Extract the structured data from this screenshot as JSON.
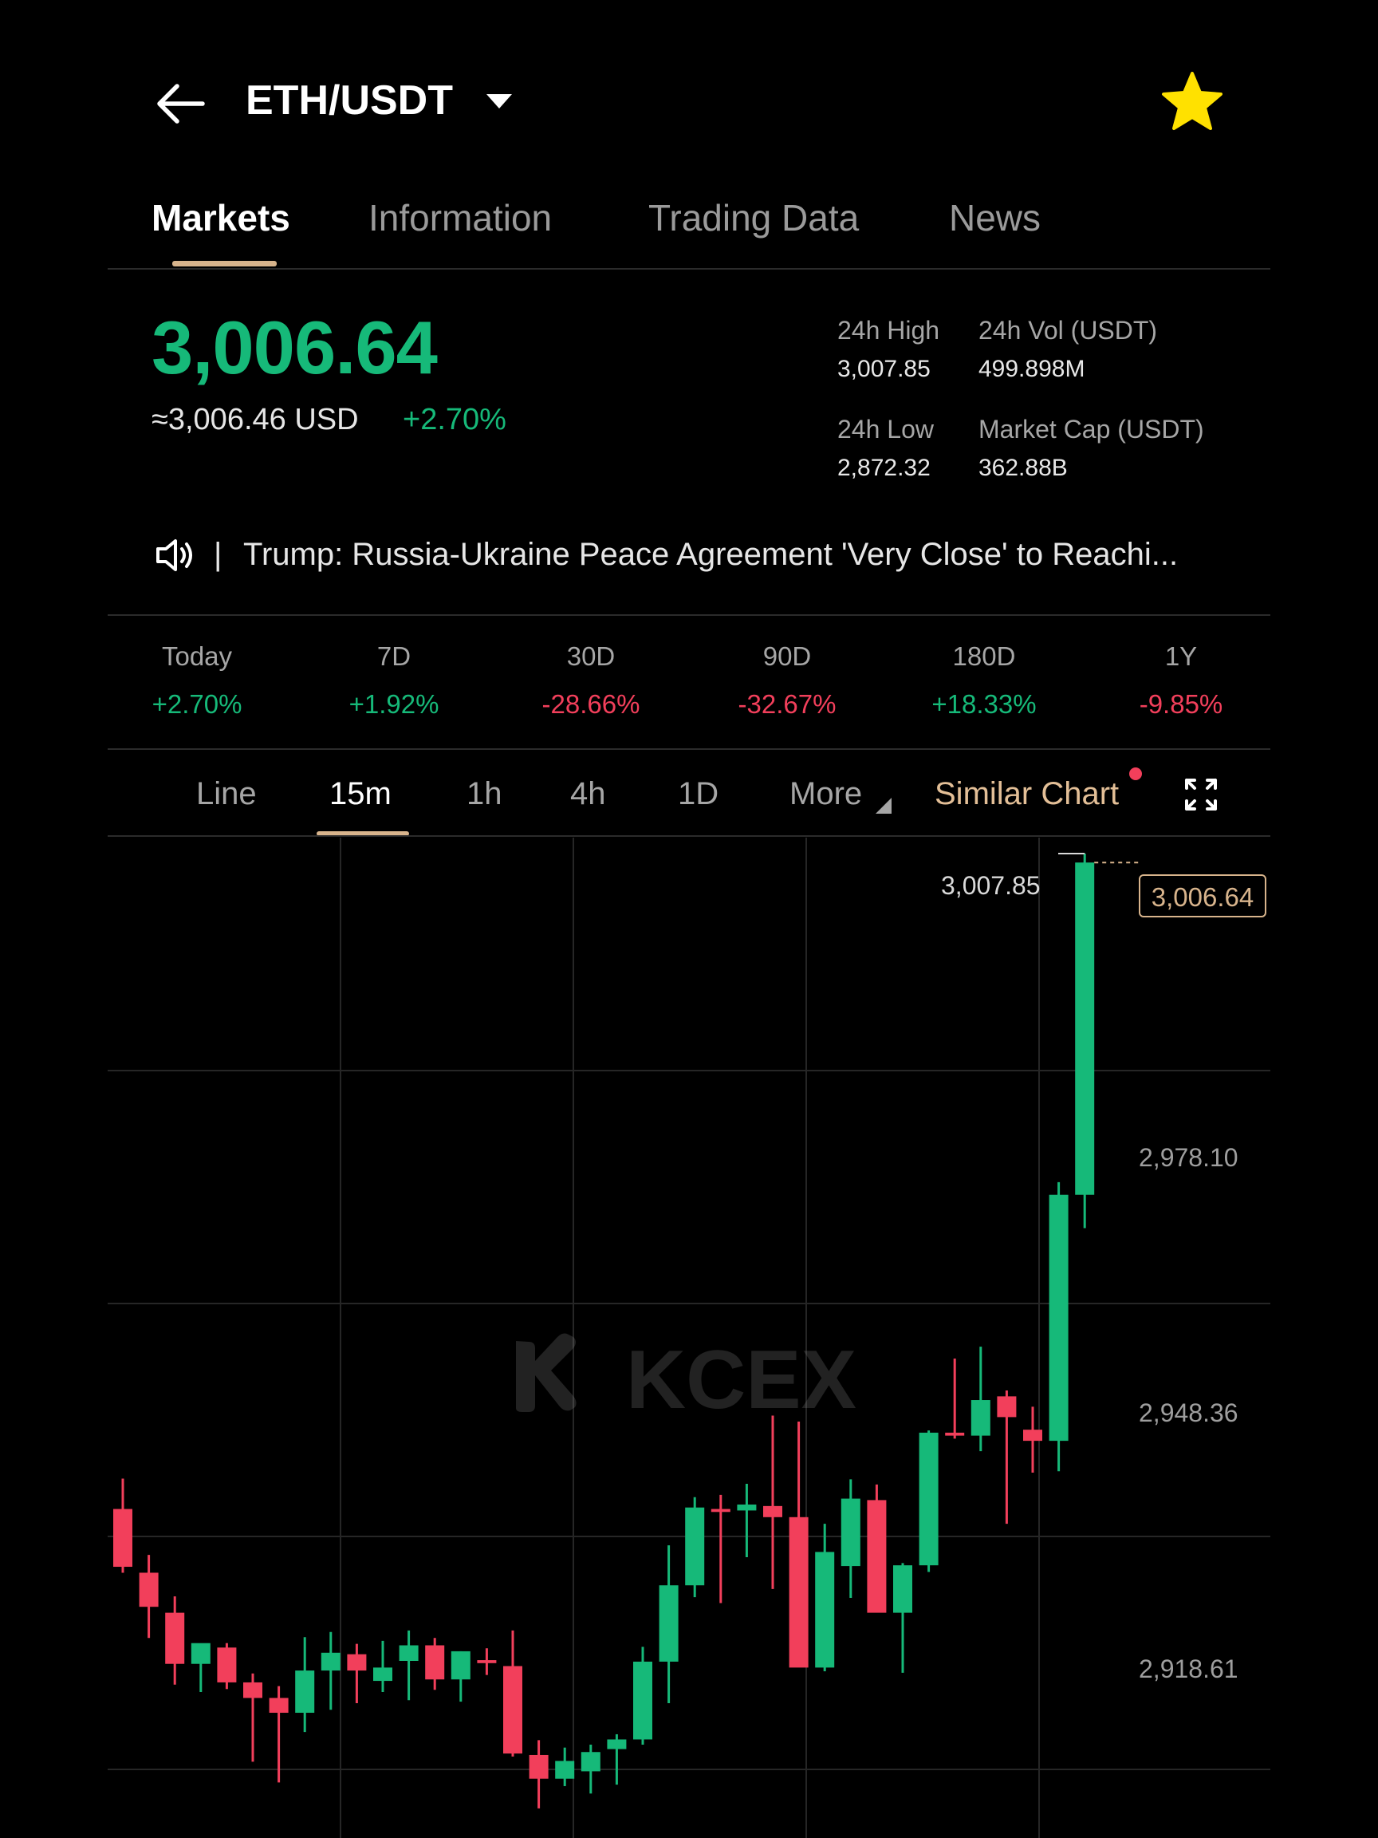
{
  "header": {
    "pair": "ETH/USDT",
    "icons": [
      "back-arrow-icon",
      "dropdown-caret-icon",
      "star-icon"
    ],
    "star_color": "#FFE100"
  },
  "tabs": [
    {
      "label": "Markets",
      "active": true
    },
    {
      "label": "Information",
      "active": false
    },
    {
      "label": "Trading Data",
      "active": false
    },
    {
      "label": "News",
      "active": false
    }
  ],
  "price": {
    "last": "3,006.64",
    "usd_equiv": "≈3,006.46 USD",
    "change": "+2.70%",
    "color_up": "#16B979"
  },
  "stats": {
    "high_label": "24h High",
    "high_value": "3,007.85",
    "vol_label": "24h Vol (USDT)",
    "vol_value": "499.898M",
    "low_label": "24h Low",
    "low_value": "2,872.32",
    "cap_label": "Market Cap (USDT)",
    "cap_value": "362.88B"
  },
  "news": {
    "separator": "|",
    "headline": "Trump: Russia-Ukraine Peace Agreement 'Very Close' to Reachi..."
  },
  "periods": [
    {
      "label": "Today",
      "value": "+2.70%",
      "up": true
    },
    {
      "label": "7D",
      "value": "+1.92%",
      "up": true
    },
    {
      "label": "30D",
      "value": "-28.66%",
      "up": false
    },
    {
      "label": "90D",
      "value": "-32.67%",
      "up": false
    },
    {
      "label": "180D",
      "value": "+18.33%",
      "up": true
    },
    {
      "label": "1Y",
      "value": "-9.85%",
      "up": false
    }
  ],
  "intervals": {
    "line": "Line",
    "m15": "15m",
    "h1": "1h",
    "h4": "4h",
    "d1": "1D",
    "more": "More",
    "similar": "Similar Chart",
    "active": "15m"
  },
  "chart_data": {
    "type": "candlestick",
    "interval": "15m",
    "y_ticks": [
      "2,978.10",
      "2,948.36",
      "2,918.61"
    ],
    "high_marker": "3,007.85",
    "last_price_marker": "3,006.64",
    "watermark": "KCEX",
    "grid": true,
    "up_color": "#16B979",
    "down_color": "#F23F5B",
    "candles": [
      {
        "o": 2919.4,
        "h": 2923.5,
        "l": 2910.8,
        "c": 2911.6
      },
      {
        "o": 2910.8,
        "h": 2913.2,
        "l": 2902.0,
        "c": 2906.2
      },
      {
        "o": 2905.4,
        "h": 2907.6,
        "l": 2895.7,
        "c": 2898.5
      },
      {
        "o": 2898.5,
        "h": 2900.7,
        "l": 2894.7,
        "c": 2901.3
      },
      {
        "o": 2900.7,
        "h": 2901.3,
        "l": 2895.1,
        "c": 2896.0
      },
      {
        "o": 2896.0,
        "h": 2897.2,
        "l": 2885.3,
        "c": 2893.9
      },
      {
        "o": 2893.9,
        "h": 2895.5,
        "l": 2882.5,
        "c": 2891.9
      },
      {
        "o": 2891.9,
        "h": 2902.1,
        "l": 2889.3,
        "c": 2897.6
      },
      {
        "o": 2897.6,
        "h": 2902.8,
        "l": 2892.3,
        "c": 2900.0
      },
      {
        "o": 2899.8,
        "h": 2901.2,
        "l": 2893.2,
        "c": 2897.6
      },
      {
        "o": 2896.2,
        "h": 2901.6,
        "l": 2894.7,
        "c": 2898.0
      },
      {
        "o": 2898.9,
        "h": 2903.0,
        "l": 2893.6,
        "c": 2901.0
      },
      {
        "o": 2901.0,
        "h": 2902.0,
        "l": 2895.0,
        "c": 2896.4
      },
      {
        "o": 2896.4,
        "h": 2900.2,
        "l": 2893.4,
        "c": 2900.2
      },
      {
        "o": 2899.0,
        "h": 2900.6,
        "l": 2897.0,
        "c": 2898.6
      },
      {
        "o": 2898.2,
        "h": 2903.0,
        "l": 2886.0,
        "c": 2886.4
      },
      {
        "o": 2886.2,
        "h": 2888.2,
        "l": 2879.0,
        "c": 2883.0
      },
      {
        "o": 2883.0,
        "h": 2887.2,
        "l": 2882.0,
        "c": 2885.4
      },
      {
        "o": 2884.0,
        "h": 2887.6,
        "l": 2881.0,
        "c": 2886.6
      },
      {
        "o": 2887.0,
        "h": 2889.0,
        "l": 2882.2,
        "c": 2888.3
      },
      {
        "o": 2888.3,
        "h": 2900.8,
        "l": 2887.6,
        "c": 2898.8
      },
      {
        "o": 2898.8,
        "h": 2914.5,
        "l": 2893.2,
        "c": 2909.1
      },
      {
        "o": 2909.1,
        "h": 2921.0,
        "l": 2907.5,
        "c": 2919.6
      },
      {
        "o": 2919.4,
        "h": 2921.3,
        "l": 2906.7,
        "c": 2919.0
      },
      {
        "o": 2919.2,
        "h": 2922.8,
        "l": 2912.9,
        "c": 2920.0
      },
      {
        "o": 2919.8,
        "h": 2932.0,
        "l": 2908.6,
        "c": 2918.3
      },
      {
        "o": 2918.3,
        "h": 2931.2,
        "l": 2903.2,
        "c": 2898.0
      },
      {
        "o": 2898.0,
        "h": 2917.4,
        "l": 2897.5,
        "c": 2913.6
      },
      {
        "o": 2911.7,
        "h": 2923.4,
        "l": 2907.4,
        "c": 2920.8
      },
      {
        "o": 2920.6,
        "h": 2922.7,
        "l": 2907.4,
        "c": 2905.4
      },
      {
        "o": 2905.4,
        "h": 2912.1,
        "l": 2897.3,
        "c": 2911.8
      },
      {
        "o": 2911.8,
        "h": 2930.0,
        "l": 2910.9,
        "c": 2929.7
      },
      {
        "o": 2929.7,
        "h": 2939.7,
        "l": 2928.9,
        "c": 2929.3
      },
      {
        "o": 2929.3,
        "h": 2941.3,
        "l": 2927.2,
        "c": 2934.1
      },
      {
        "o": 2934.6,
        "h": 2935.4,
        "l": 2917.4,
        "c": 2931.8
      },
      {
        "o": 2930.1,
        "h": 2933.2,
        "l": 2924.3,
        "c": 2928.6
      },
      {
        "o": 2928.6,
        "h": 2963.5,
        "l": 2924.5,
        "c": 2961.8
      },
      {
        "o": 2961.8,
        "h": 3007.85,
        "l": 2957.3,
        "c": 3006.64
      }
    ]
  }
}
